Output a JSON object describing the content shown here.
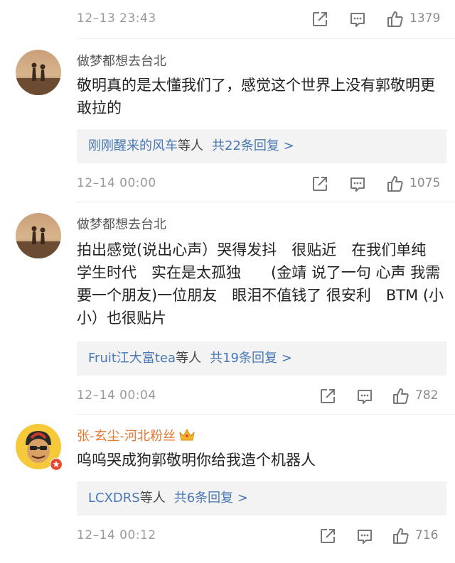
{
  "top_action": {
    "time": "12–13 23:43",
    "likes": "1379"
  },
  "comments": [
    {
      "username": "做梦都想去台北",
      "text": "敬明真的是太懂我们了，感觉这个世界上没有郭敬明更敢拉的",
      "reply_names": "刚刚醒来的风车",
      "reply_suffix": "等人",
      "reply_count": "共22条回复 >",
      "time": "12–14 00:00",
      "likes": "1075"
    },
    {
      "username": "做梦都想去台北",
      "text": "拍出感觉(说出心声）哭得发抖　很贴近　在我们单纯　学生时代　实在是太孤独　　(金靖 说了一句 心声 我需要一个朋友)一位朋友　眼泪不值钱了 很安利　BTM (小小）也很贴片",
      "reply_names": "Fruit江大富tea",
      "reply_suffix": "等人",
      "reply_count": "共19条回复 >",
      "time": "12–14 00:04",
      "likes": "782"
    },
    {
      "username": "张-玄尘-河北粉丝",
      "text": "呜呜哭成狗郭敬明你给我造个机器人",
      "reply_names": "LCXDRS",
      "reply_suffix": "等人",
      "reply_count": "共6条回复 >",
      "time": "12–14 00:12",
      "likes": "716"
    }
  ],
  "colors": {
    "link_blue": "#4a78b5",
    "fan_orange": "#e8772e",
    "reply_bg": "#f3f3f3",
    "meta_gray": "#9a9a9a"
  },
  "icons": [
    "share-icon",
    "comment-icon",
    "like-icon",
    "crown-badge-icon",
    "verified-badge-icon"
  ]
}
